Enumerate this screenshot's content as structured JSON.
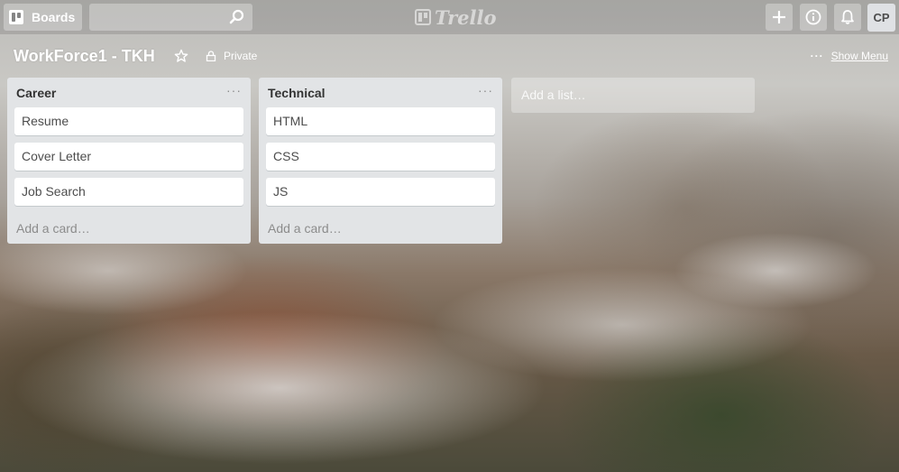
{
  "header": {
    "boards_label": "Boards",
    "search": {
      "value": "",
      "placeholder": ""
    },
    "logo_text": "Trello",
    "avatar_initials": "CP"
  },
  "board": {
    "title": "WorkForce1 - TKH",
    "visibility": "Private",
    "show_menu_label": "Show Menu",
    "menu_dots": "···"
  },
  "lists": [
    {
      "title": "Career",
      "menu": "···",
      "cards": [
        "Resume",
        "Cover Letter",
        "Job Search"
      ],
      "add_card_label": "Add a card…"
    },
    {
      "title": "Technical",
      "menu": "···",
      "cards": [
        "HTML",
        "CSS",
        "JS"
      ],
      "add_card_label": "Add a card…"
    }
  ],
  "add_list_label": "Add a list…",
  "icons": {
    "boards": "boards-icon",
    "search": "search-icon",
    "add": "plus-icon",
    "info": "info-icon",
    "notifications": "bell-icon",
    "star": "star-icon",
    "lock": "lock-icon"
  },
  "colors": {
    "list_bg": "#e2e4e6",
    "card_bg": "#ffffff",
    "header_button_bg": "rgba(255,255,255,0.3)"
  }
}
